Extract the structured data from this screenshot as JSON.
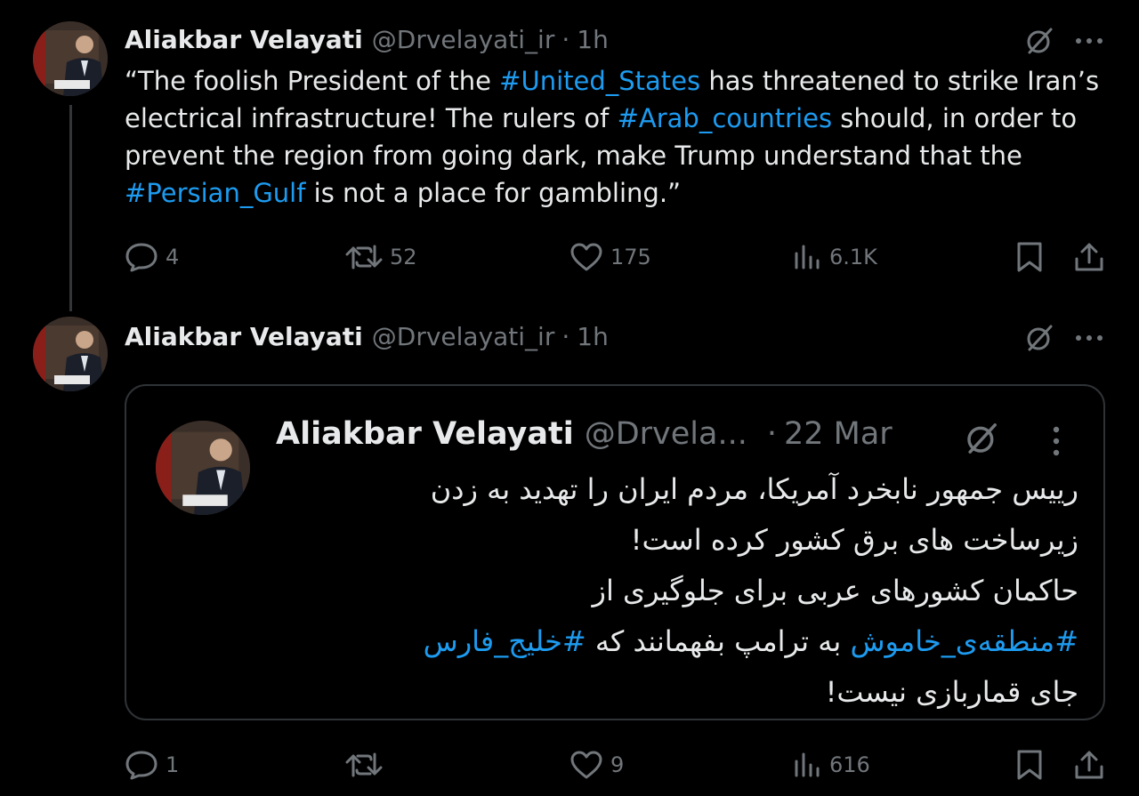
{
  "tweet1": {
    "author_name": "Aliakbar Velayati",
    "handle": "@Drvelayati_ir",
    "separator": "·",
    "time": "1h",
    "text": {
      "p1": "“The foolish President of the ",
      "tag1": "#United_States",
      "p2": " has threatened to strike Iran’s electrical infrastructure! The rulers of ",
      "tag2": "#Arab_countries",
      "p3": " should, in order to prevent the region from going dark, make Trump understand that the ",
      "tag3": "#Persian_Gulf",
      "p4": " is not a place for gambling.”"
    },
    "stats": {
      "replies": "4",
      "reposts": "52",
      "likes": "175",
      "views": "6.1K"
    }
  },
  "tweet2": {
    "author_name": "Aliakbar Velayati",
    "handle": "@Drvelayati_ir",
    "separator": "·",
    "time": "1h",
    "quote": {
      "author_name": "Aliakbar Velayati",
      "handle": "@Drvela...",
      "separator": "·",
      "time": "22 Mar",
      "lines": {
        "l1": "رییس جمهور نابخرد آمریکا، مردم ایران را تهدید به زدن",
        "l2": "زیرساخت های برق کشور کرده است!",
        "l3": "حاکمان کشورهای عربی برای جلوگیری از",
        "l4_tag1": "#منطقه‌ی_خاموش",
        "l4_mid": " به ترامپ بفهمانند که ",
        "l4_tag2": "#خلیج_فارس",
        "l5": "جای قماربازی نیست!"
      }
    },
    "stats": {
      "replies": "1",
      "reposts": "",
      "likes": "9",
      "views": "616"
    }
  },
  "icons": [
    "avatar",
    "grok-icon",
    "more-icon",
    "reply-icon",
    "repost-icon",
    "like-icon",
    "views-icon",
    "bookmark-icon",
    "share-icon"
  ],
  "colors": {
    "background": "#000000",
    "text": "#e7e9ea",
    "secondary": "#71767b",
    "link": "#1d9bf0",
    "border": "#2f3336"
  }
}
